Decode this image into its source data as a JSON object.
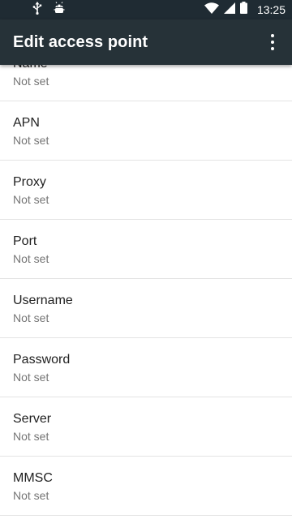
{
  "status_bar": {
    "time": "13:25",
    "icons": [
      "usb-icon",
      "android-debug-icon",
      "wifi-icon",
      "signal-icon",
      "battery-icon"
    ]
  },
  "app_bar": {
    "title": "Edit access point",
    "menu_icon": "more-vert-icon"
  },
  "settings": [
    {
      "title": "Name",
      "summary": "Not set"
    },
    {
      "title": "APN",
      "summary": "Not set"
    },
    {
      "title": "Proxy",
      "summary": "Not set"
    },
    {
      "title": "Port",
      "summary": "Not set"
    },
    {
      "title": "Username",
      "summary": "Not set"
    },
    {
      "title": "Password",
      "summary": "Not set"
    },
    {
      "title": "Server",
      "summary": "Not set"
    },
    {
      "title": "MMSC",
      "summary": "Not set"
    }
  ],
  "colors": {
    "status_bar": "#1f2b33",
    "app_bar": "#263238",
    "title_text": "#212121",
    "summary_text": "#757575"
  }
}
